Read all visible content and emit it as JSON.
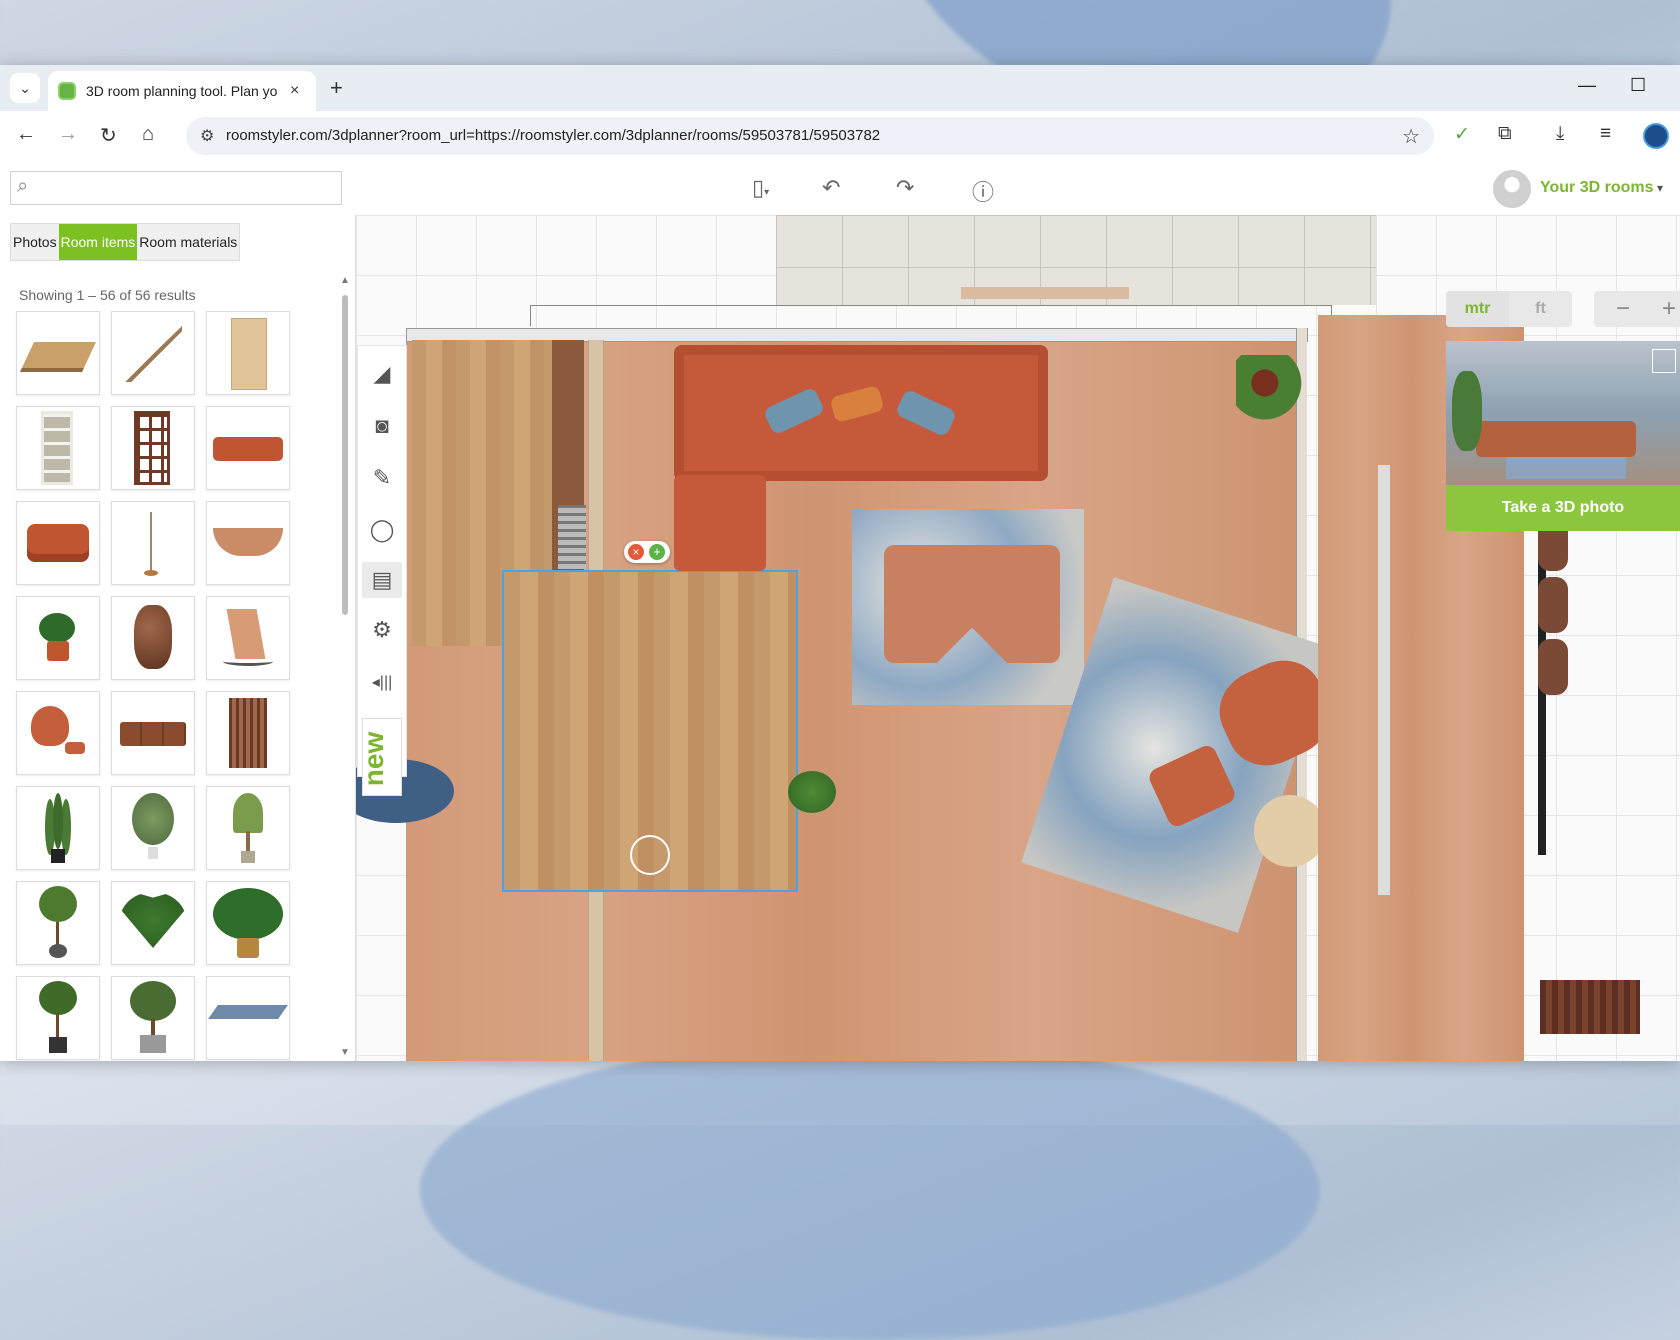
{
  "browser": {
    "tab_title": "3D room planning tool. Plan yo",
    "tab_close": "×",
    "new_tab": "+",
    "url": "roomstyler.com/3dplanner?room_url=https://roomstyler.com/3dplanner/rooms/59503781/59503782",
    "window_controls": {
      "minimize": "—",
      "maximize": "☐"
    }
  },
  "header": {
    "search_placeholder": "",
    "user_menu_label": "Your 3D rooms",
    "user_menu_caret": "▾",
    "tools": [
      "new-file-icon",
      "undo-icon",
      "redo-icon",
      "info-icon"
    ]
  },
  "left_panel": {
    "tabs": [
      {
        "label": "Photos",
        "active": false
      },
      {
        "label": "Room items",
        "active": true
      },
      {
        "label": "Room materials",
        "active": false
      }
    ],
    "results_text": "Showing 1 – 56 of 56 results",
    "items": [
      "square-table",
      "staircase",
      "wooden-door",
      "white-bookcase",
      "room-divider-shelf",
      "orange-sofa",
      "orange-ottoman",
      "floor-lamp",
      "curved-bench",
      "potted-plant-small",
      "copper-vase",
      "rocking-chair",
      "egg-chair-with-ottoman",
      "sofa-cushions",
      "wooden-trellis-bench",
      "snake-plant",
      "potted-ficus",
      "yucca-plant",
      "potted-tree",
      "fan-palm",
      "monstera-plant",
      "topiary-tree-square-pot",
      "olive-tree-grey-pot",
      "blue-rug"
    ]
  },
  "side_tools": {
    "items": [
      "floor-trowel-icon",
      "armchair-icon",
      "paint-brush-icon",
      "light-bulb-icon",
      "clipboard-icon",
      "settings-gear-icon",
      "collapse-panel-icon"
    ],
    "new_badge": "new"
  },
  "right_panel": {
    "units": [
      {
        "label": "mtr",
        "active": true
      },
      {
        "label": "ft",
        "active": false
      }
    ],
    "zoom_out": "−",
    "zoom_in": "+",
    "photo_button": "Take a 3D photo"
  },
  "colors": {
    "accent_green": "#7cc021",
    "sofa_orange": "#c85a38",
    "floor_wood": "#d39c7b"
  }
}
